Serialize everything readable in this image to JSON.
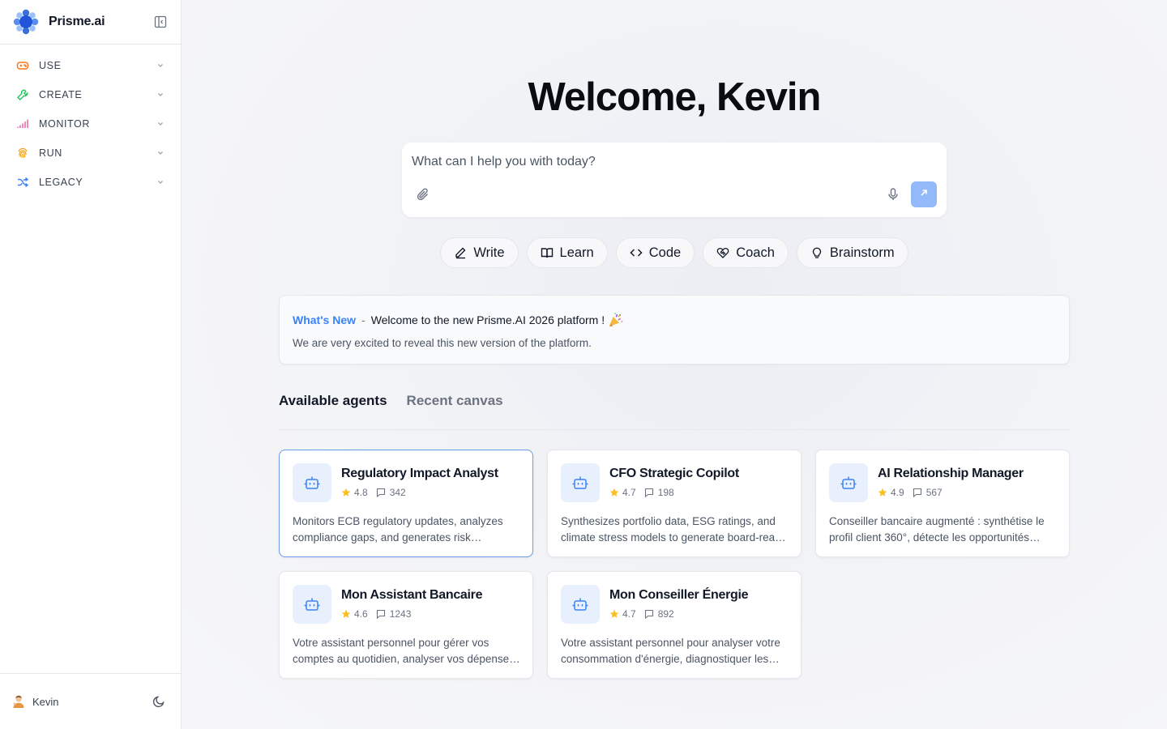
{
  "app": {
    "name": "Prisme.ai"
  },
  "sidebar": {
    "items": [
      {
        "label": "USE",
        "icon": "gamepad-icon",
        "color": "#f97316"
      },
      {
        "label": "CREATE",
        "icon": "wrench-icon",
        "color": "#22c55e"
      },
      {
        "label": "MONITOR",
        "icon": "signal-bars-icon",
        "color": "#ec4899"
      },
      {
        "label": "RUN",
        "icon": "fingerprint-icon",
        "color": "#f59e0b"
      },
      {
        "label": "LEGACY",
        "icon": "shuffle-icon",
        "color": "#3b82f6"
      }
    ],
    "user": {
      "name": "Kevin"
    }
  },
  "main": {
    "welcome": "Welcome, Kevin",
    "prompt": {
      "placeholder": "What can I help you with today?"
    },
    "chips": [
      {
        "label": "Write",
        "icon": "pencil-icon"
      },
      {
        "label": "Learn",
        "icon": "book-icon"
      },
      {
        "label": "Code",
        "icon": "code-icon"
      },
      {
        "label": "Coach",
        "icon": "heart-handshake-icon"
      },
      {
        "label": "Brainstorm",
        "icon": "lightbulb-icon"
      }
    ],
    "news": {
      "tag": "What's New",
      "separator": "-",
      "title": "Welcome to the new Prisme.AI 2026 platform !",
      "emoji": "party-popper-icon",
      "description": "We are very excited to reveal this new version of the platform."
    },
    "tabs": [
      {
        "label": "Available agents",
        "active": true
      },
      {
        "label": "Recent canvas",
        "active": false
      }
    ],
    "agents": [
      {
        "name": "Regulatory Impact Analyst",
        "rating": "4.8",
        "comments": "342",
        "description": "Monitors ECB regulatory updates, analyzes compliance gaps, and generates risk assessments.",
        "selected": true
      },
      {
        "name": "CFO Strategic Copilot",
        "rating": "4.7",
        "comments": "198",
        "description": "Synthesizes portfolio data, ESG ratings, and climate stress models to generate board-ready reports.",
        "selected": false
      },
      {
        "name": "AI Relationship Manager",
        "rating": "4.9",
        "comments": "567",
        "description": "Conseiller bancaire augmenté : synthétise le profil client 360°, détecte les opportunités commerciales.",
        "selected": false
      },
      {
        "name": "Mon Assistant Bancaire",
        "rating": "4.6",
        "comments": "1243",
        "description": "Votre assistant personnel pour gérer vos comptes au quotidien, analyser vos dépenses et épargner.",
        "selected": false
      },
      {
        "name": "Mon Conseiller Énergie",
        "rating": "4.7",
        "comments": "892",
        "description": "Votre assistant personnel pour analyser votre consommation d'énergie, diagnostiquer les anomalies.",
        "selected": false
      }
    ]
  },
  "colors": {
    "accent": "#3b82f6",
    "send_button": "#93b9f8",
    "star": "#fbbf24",
    "agent_icon_bg": "#e8effd",
    "selected_border": "#6b9ae8"
  }
}
